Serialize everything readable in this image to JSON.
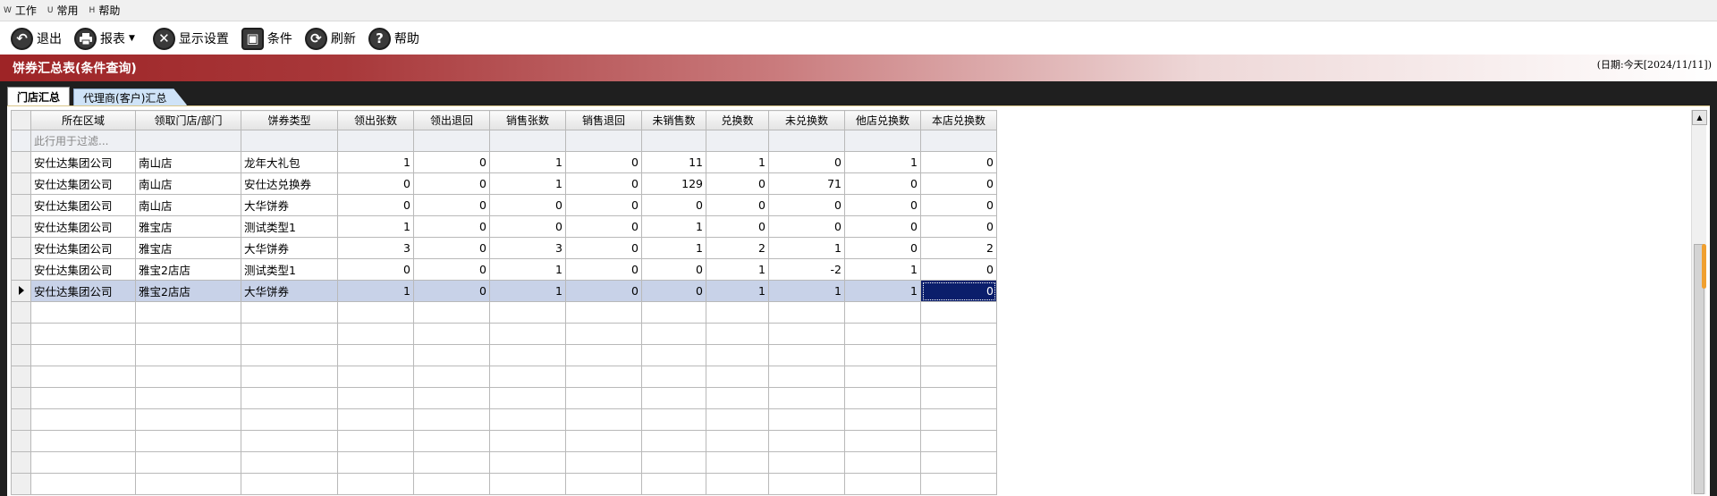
{
  "menu": [
    {
      "hotkey": "W",
      "label": "工作"
    },
    {
      "hotkey": "U",
      "label": "常用"
    },
    {
      "hotkey": "H",
      "label": "帮助"
    }
  ],
  "toolbar": {
    "exit": "退出",
    "report": "报表",
    "display_settings": "显示设置",
    "conditions": "条件",
    "refresh": "刷新",
    "help": "帮助"
  },
  "title": "饼券汇总表(条件查询)",
  "date_label": "(日期:今天[2024/11/11])",
  "tabs": {
    "store": "门店汇总",
    "agent": "代理商(客户)汇总"
  },
  "grid": {
    "columns": [
      "所在区域",
      "领取门店/部门",
      "饼券类型",
      "领出张数",
      "领出退回",
      "销售张数",
      "销售退回",
      "未销售数",
      "兑换数",
      "未兑换数",
      "他店兑换数",
      "本店兑换数"
    ],
    "filter_placeholder": "此行用于过滤...",
    "rows": [
      [
        "安仕达集团公司",
        "南山店",
        "龙年大礼包",
        "1",
        "0",
        "1",
        "0",
        "11",
        "1",
        "0",
        "1",
        "0"
      ],
      [
        "安仕达集团公司",
        "南山店",
        "安仕达兑换券",
        "0",
        "0",
        "1",
        "0",
        "129",
        "0",
        "71",
        "0",
        "0"
      ],
      [
        "安仕达集团公司",
        "南山店",
        "大华饼券",
        "0",
        "0",
        "0",
        "0",
        "0",
        "0",
        "0",
        "0",
        "0"
      ],
      [
        "安仕达集团公司",
        "雅宝店",
        "测试类型1",
        "1",
        "0",
        "0",
        "0",
        "1",
        "0",
        "0",
        "0",
        "0"
      ],
      [
        "安仕达集团公司",
        "雅宝店",
        "大华饼券",
        "3",
        "0",
        "3",
        "0",
        "1",
        "2",
        "1",
        "0",
        "2"
      ],
      [
        "安仕达集团公司",
        "雅宝2店店",
        "测试类型1",
        "0",
        "0",
        "1",
        "0",
        "0",
        "1",
        "-2",
        "1",
        "0"
      ],
      [
        "安仕达集团公司",
        "雅宝2店店",
        "大华饼券",
        "1",
        "0",
        "1",
        "0",
        "0",
        "1",
        "1",
        "1",
        "0"
      ]
    ],
    "selected_row": 6,
    "empty_rows": 9
  },
  "colors": {
    "title_red": "#9e2426",
    "selection": "#c8d2e8",
    "current_cell": "#0b1e6b"
  },
  "icons": {
    "exit": "undo-icon",
    "report": "printer-icon",
    "display_settings": "tools-icon",
    "conditions": "filter-icon",
    "refresh": "refresh-icon",
    "help": "question-icon"
  }
}
